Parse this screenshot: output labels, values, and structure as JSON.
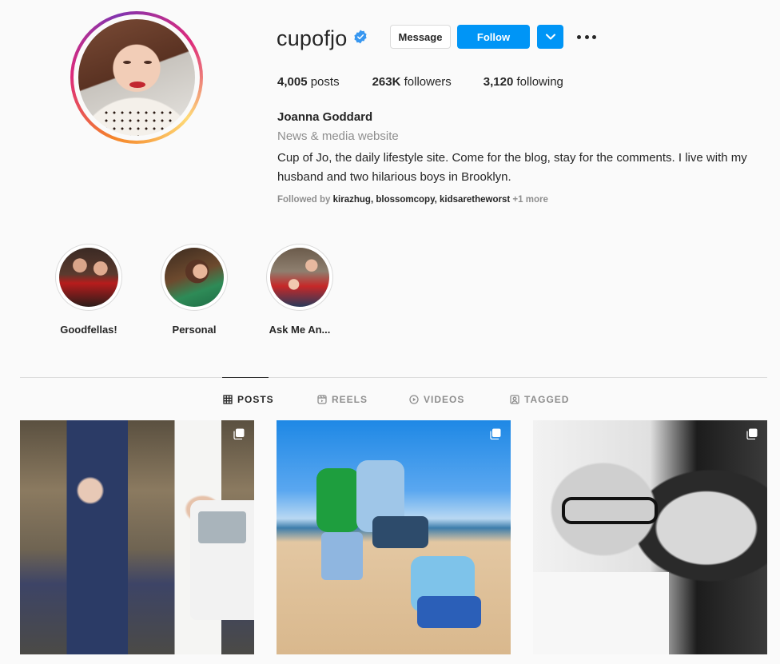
{
  "profile": {
    "username": "cupofjo",
    "message_label": "Message",
    "follow_label": "Follow",
    "stats": {
      "posts_count": "4,005",
      "posts_label": "posts",
      "followers_count": "263K",
      "followers_label": "followers",
      "following_count": "3,120",
      "following_label": "following"
    },
    "full_name": "Joanna Goddard",
    "category": "News & media website",
    "bio": "Cup of Jo, the daily lifestyle site. Come for the blog, stay for the comments. I live with my husband and two hilarious boys in Brooklyn.",
    "followed_by": {
      "prefix": "Followed by",
      "users": [
        "kirazhug",
        "blossomcopy",
        "kidsaretheworst"
      ],
      "more": "+1 more"
    }
  },
  "highlights": [
    {
      "label": "Goodfellas!"
    },
    {
      "label": "Personal"
    },
    {
      "label": "Ask Me An..."
    }
  ],
  "tabs": [
    {
      "label": "POSTS",
      "active": true
    },
    {
      "label": "REELS",
      "active": false
    },
    {
      "label": "VIDEOS",
      "active": false
    },
    {
      "label": "TAGGED",
      "active": false
    }
  ],
  "colors": {
    "accent": "#0095f6",
    "background": "#fafafa",
    "muted_text": "#8e8e8e"
  },
  "icons": [
    "verified-badge-icon",
    "chevron-down-icon",
    "more-options-icon",
    "grid-icon",
    "reels-icon",
    "video-icon",
    "tagged-icon",
    "multiple-photos-icon"
  ]
}
